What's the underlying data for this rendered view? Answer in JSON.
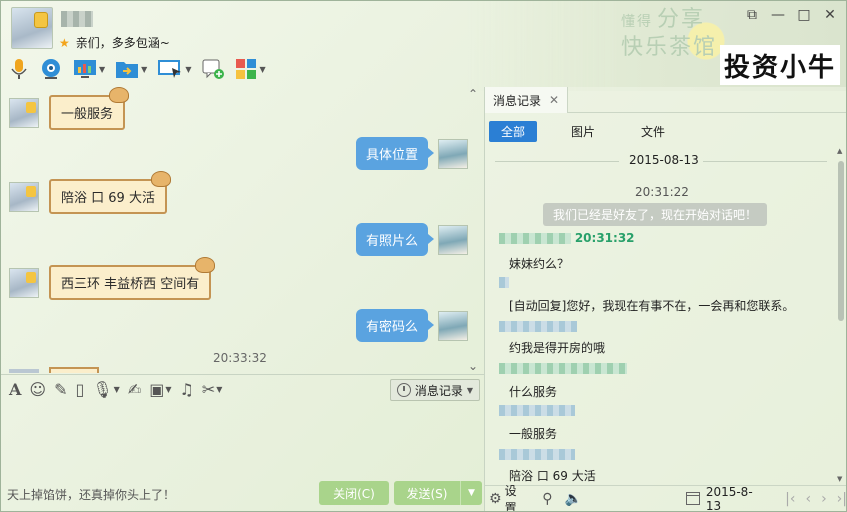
{
  "header": {
    "status_text": "亲们，多多包涵~",
    "brand_text": "投资小牛",
    "bg_slogan_small": "懂得",
    "bg_slogan_line1": "分享",
    "bg_slogan_line2": "快乐茶馆"
  },
  "window_controls": {
    "minimize": "—",
    "restore": "□",
    "close": "✕",
    "extra": "⧉"
  },
  "chat": {
    "messages": [
      {
        "side": "left",
        "text": "一般服务"
      },
      {
        "side": "right",
        "text": "具体位置"
      },
      {
        "side": "left",
        "text": "陪浴 口 69  大活"
      },
      {
        "side": "right",
        "text": "有照片么"
      },
      {
        "side": "left",
        "text": "西三环 丰益桥西 空间有"
      },
      {
        "side": "right",
        "text": "有密码么"
      }
    ],
    "time": "20:33:32"
  },
  "input_toolbar": {
    "history_label": "消息记录"
  },
  "bottom_bar": {
    "tip": "天上掉馅饼，还真掉你头上了！",
    "close_label": "关闭(C)",
    "send_label": "发送(S)"
  },
  "history": {
    "tab_label": "消息记录",
    "filters": [
      "全部",
      "图片",
      "文件"
    ],
    "date": "2015-08-13",
    "first_time": "20:31:22",
    "system_note": "我们已经是好友了，现在开始对话吧！",
    "entry_time": "20:31:32",
    "lines": [
      "妹妹约么？",
      "[自动回复]您好，我现在有事不在，一会再和您联系。",
      "约我是得开房的哦",
      "什么服务",
      "一般服务",
      "陪浴 口 69  大活"
    ],
    "footer": {
      "settings_label": "设置",
      "date": "2015-8-13"
    }
  },
  "colors": {
    "accent_blue": "#2b7fd4",
    "bubble_blue": "#5aa3e0",
    "button_green": "#a9d48b",
    "timestamp_green": "#28a06a"
  }
}
